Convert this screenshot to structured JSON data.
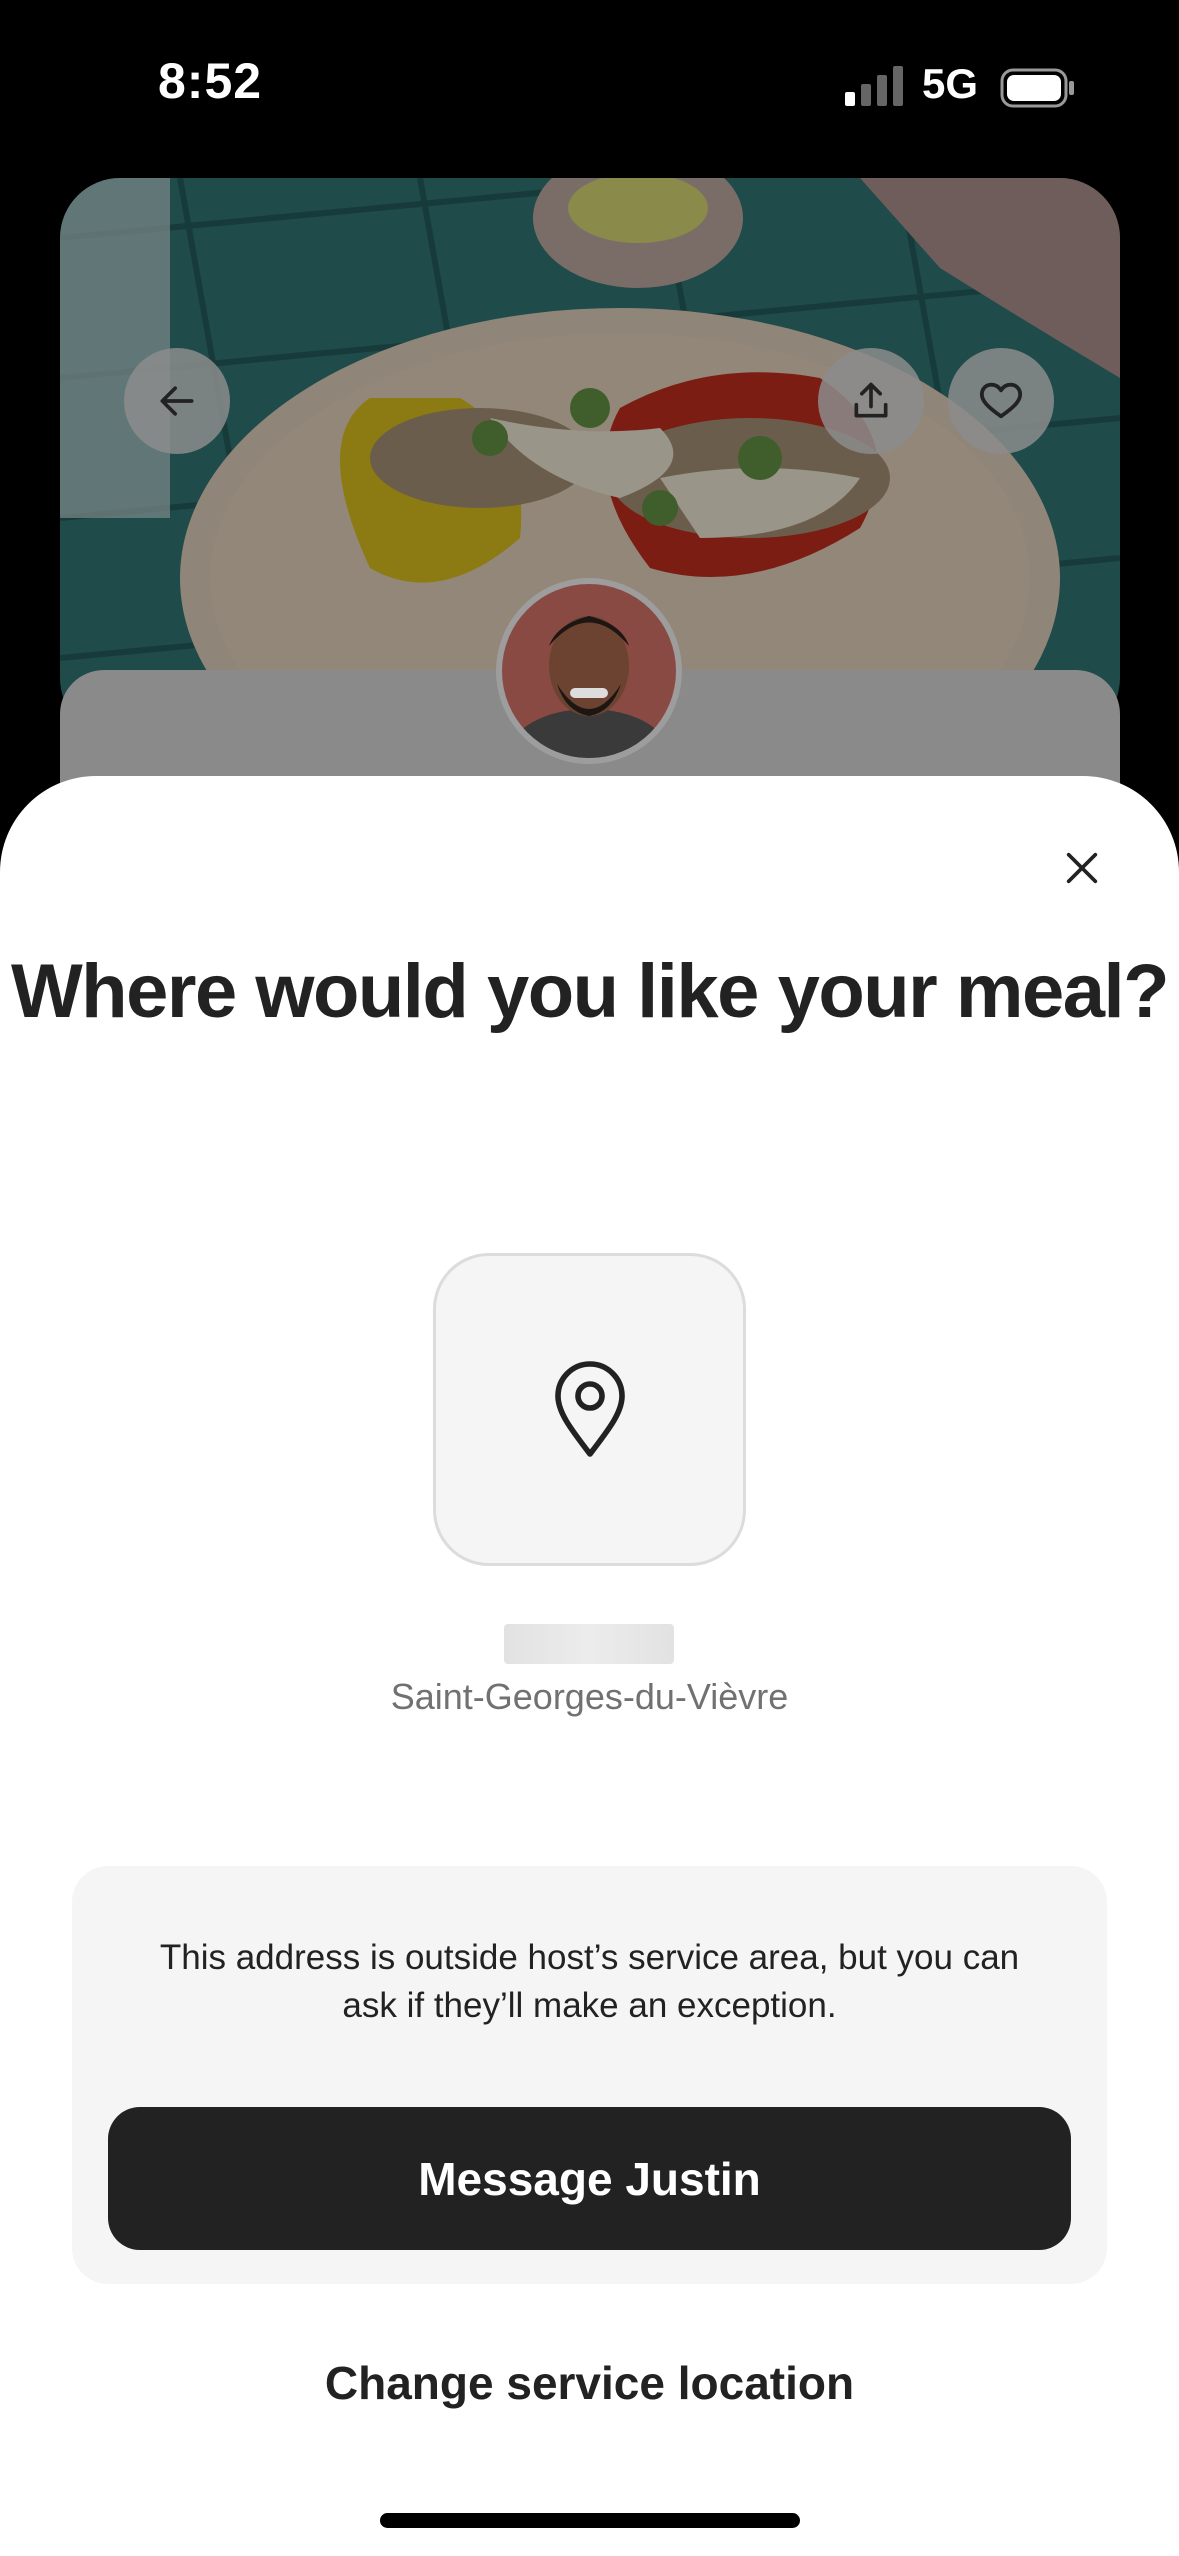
{
  "status_bar": {
    "time": "8:52",
    "network": "5G",
    "icons": [
      "signal-icon",
      "battery-icon"
    ]
  },
  "listing": {
    "icons": [
      "back-arrow-icon",
      "share-icon",
      "heart-icon"
    ]
  },
  "sheet": {
    "title": "Where would you like your meal?",
    "pin_icon": "map-pin-icon",
    "address_city": "Saint-Georges-du-Vièvre",
    "notice": "This address is outside host’s service area, but you can ask if they’ll make an exception.",
    "message_button": "Message Justin",
    "change_link": "Change service location",
    "close_icon": "close-icon"
  },
  "colors": {
    "primary_dark": "#222222",
    "muted_text": "#717171",
    "surface": "#f5f5f5"
  }
}
